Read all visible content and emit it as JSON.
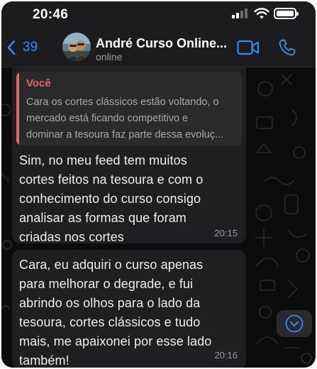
{
  "status_bar": {
    "time": "20:46"
  },
  "header": {
    "back_count": "39",
    "contact_name": "André Curso Online...",
    "contact_status": "online"
  },
  "messages": [
    {
      "quote_author": "Você",
      "quote_lines": [
        "Cara os cortes clássicos estão voltando, o",
        "mercado está ficando competitivo e",
        "dominar a tesoura faz parte dessa evoluç..."
      ],
      "text_lines": [
        "Sim, no meu feed tem muitos",
        "cortes feitos na tesoura e com o",
        "conhecimento do curso consigo",
        "analisar as formas que foram",
        "criadas nos cortes"
      ],
      "time": "20:15"
    },
    {
      "text_lines": [
        "Cara, eu adquiri o curso apenas",
        "para melhorar o degrade, e fui",
        "abrindo os olhos para o lado da",
        "tesoura, cortes clássicos e tudo",
        "mais, me apaixonei por esse lado",
        "também!"
      ],
      "time": "20:16"
    }
  ],
  "colors": {
    "accent": "#2f8cf5",
    "quote_author": "#e06a5f",
    "bubble": "#1f1f21",
    "background": "#0c0c0c"
  },
  "icons": [
    "chevron-left-icon",
    "video-call-icon",
    "phone-icon",
    "chevron-down-icon",
    "wifi-icon",
    "signal-icon",
    "battery-icon"
  ]
}
